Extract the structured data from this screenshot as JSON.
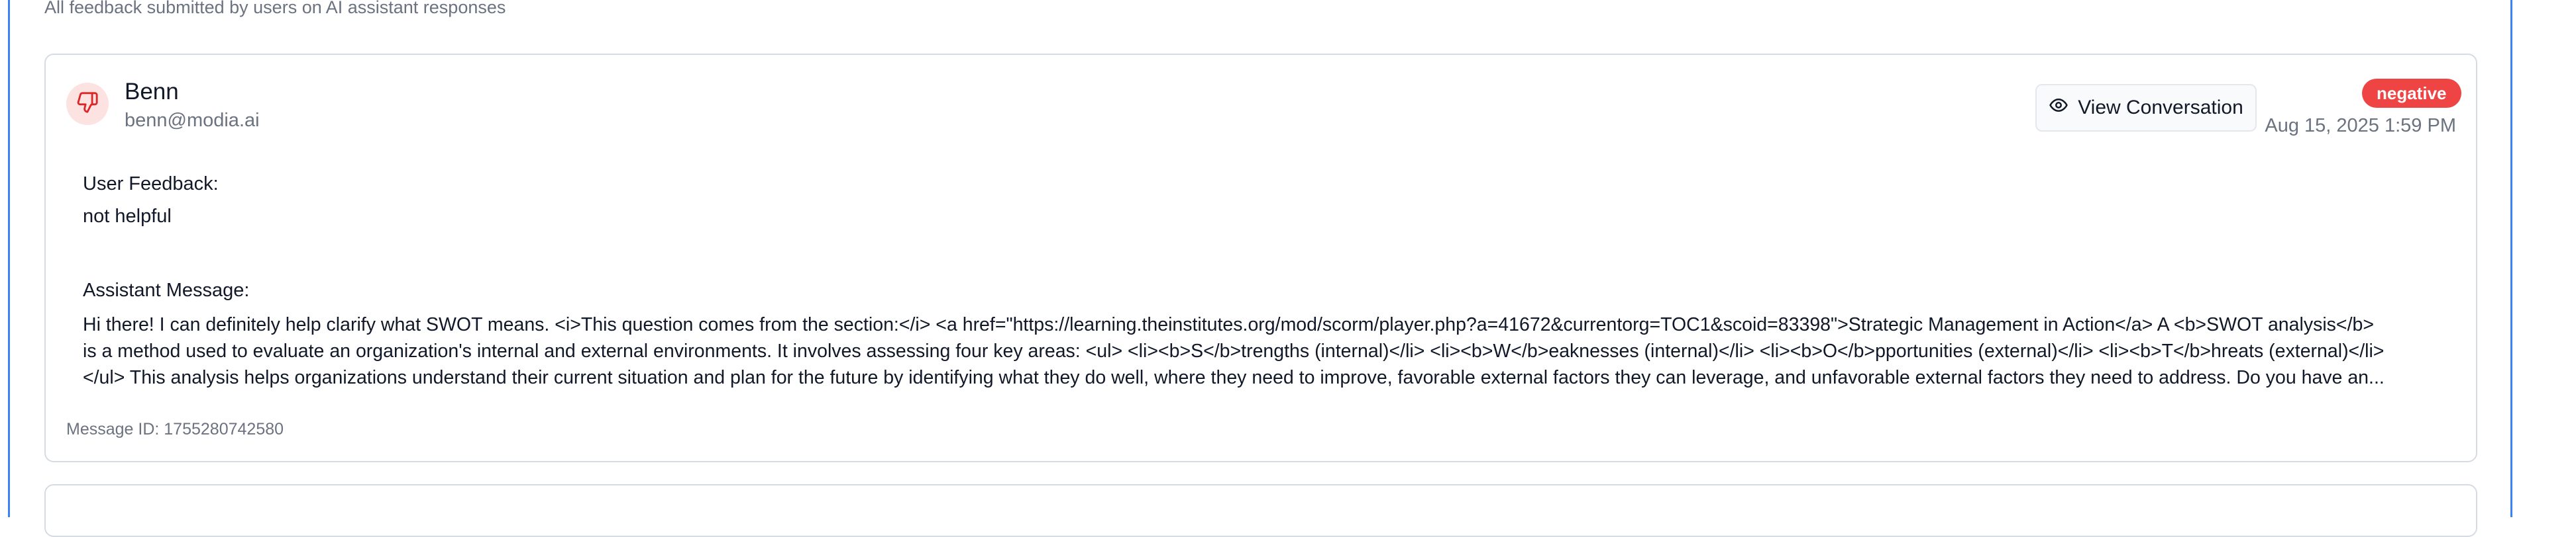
{
  "header": {
    "subtitle": "All feedback submitted by users on AI assistant responses"
  },
  "feedback_card": {
    "user_name": "Benn",
    "user_email": "benn@modia.ai",
    "view_button_label": "View Conversation",
    "sentiment_badge": "negative",
    "timestamp": "Aug 15, 2025 1:59 PM",
    "user_feedback_label": "User Feedback:",
    "user_feedback_text": "not helpful",
    "assistant_message_label": "Assistant Message:",
    "assistant_message_lines": [
      "Hi there! I can definitely help clarify what SWOT means. <i>This question comes from the section:</i> <a href=\"https://learning.theinstitutes.org/mod/scorm/player.php?a=41672&currentorg=TOC1&scoid=83398\">Strategic Management in Action</a> A <b>SWOT analysis</b>",
      "is a method used to evaluate an organization's internal and external environments. It involves assessing four key areas: <ul> <li><b>S</b>trengths (internal)</li> <li><b>W</b>eaknesses (internal)</li> <li><b>O</b>pportunities (external)</li> <li><b>T</b>hreats (external)</li>",
      "</ul> This analysis helps organizations understand their current situation and plan for the future by identifying what they do well, where they need to improve, favorable external factors they can leverage, and unfavorable external factors they need to address. Do you have an..."
    ],
    "message_id": "Message ID: 1755280742580"
  },
  "icons": {
    "avatar_icon": "thumbs-down-icon",
    "view_icon": "eye-icon"
  },
  "colors": {
    "accent_border": "#3b82f6",
    "negative_badge": "#ef4444",
    "avatar_bg": "#fde2e2",
    "thumb_icon": "#dc2626"
  }
}
